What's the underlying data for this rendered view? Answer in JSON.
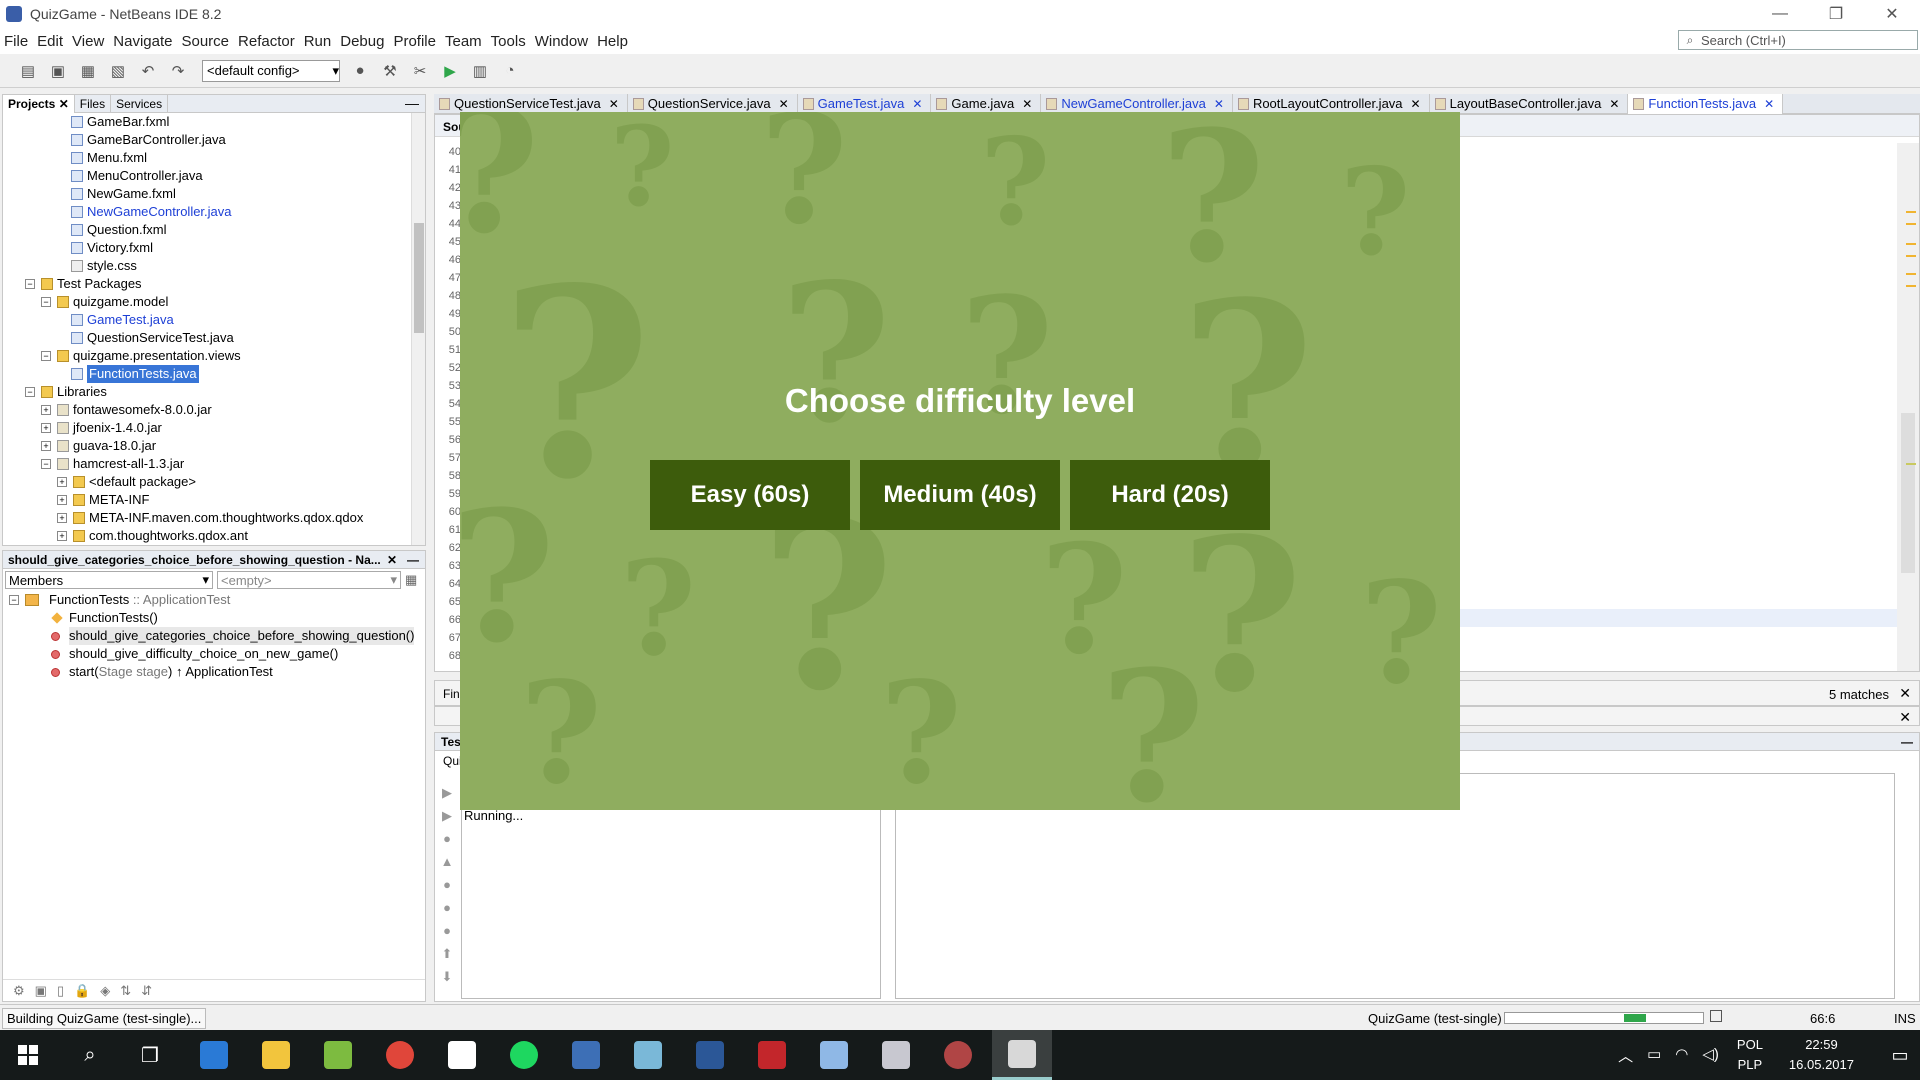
{
  "window": {
    "title": "QuizGame - NetBeans IDE 8.2",
    "controls": [
      "—",
      "❐",
      "✕"
    ]
  },
  "menu": [
    "File",
    "Edit",
    "View",
    "Navigate",
    "Source",
    "Refactor",
    "Run",
    "Debug",
    "Profile",
    "Team",
    "Tools",
    "Window",
    "Help"
  ],
  "search": {
    "placeholder": "Search (Ctrl+I)"
  },
  "toolbar": {
    "config": "<default config>"
  },
  "projects_panel": {
    "tabs": [
      "Projects",
      "Files",
      "Services"
    ],
    "tree": [
      {
        "label": "GameBar.fxml",
        "kind": "file",
        "level": 4
      },
      {
        "label": "GameBarController.java",
        "kind": "file",
        "level": 4
      },
      {
        "label": "Menu.fxml",
        "kind": "file",
        "level": 4
      },
      {
        "label": "MenuController.java",
        "kind": "file",
        "level": 4
      },
      {
        "label": "NewGame.fxml",
        "kind": "file",
        "level": 4
      },
      {
        "label": "NewGameController.java",
        "kind": "file",
        "level": 4,
        "style": "blue"
      },
      {
        "label": "Question.fxml",
        "kind": "file",
        "level": 4
      },
      {
        "label": "Victory.fxml",
        "kind": "file",
        "level": 4
      },
      {
        "label": "style.css",
        "kind": "css",
        "level": 4
      },
      {
        "label": "Test Packages",
        "kind": "folder",
        "level": 1,
        "expander": "−"
      },
      {
        "label": "quizgame.model",
        "kind": "folder",
        "level": 2,
        "expander": "−"
      },
      {
        "label": "GameTest.java",
        "kind": "file",
        "level": 4,
        "style": "blue"
      },
      {
        "label": "QuestionServiceTest.java",
        "kind": "file",
        "level": 4
      },
      {
        "label": "quizgame.presentation.views",
        "kind": "folder",
        "level": 2,
        "expander": "−"
      },
      {
        "label": "FunctionTests.java",
        "kind": "file",
        "level": 4,
        "style": "sel"
      },
      {
        "label": "Libraries",
        "kind": "folder",
        "level": 1,
        "expander": "−"
      },
      {
        "label": "fontawesomefx-8.0.0.jar",
        "kind": "jar",
        "level": 2,
        "expander": "+"
      },
      {
        "label": "jfoenix-1.4.0.jar",
        "kind": "jar",
        "level": 2,
        "expander": "+"
      },
      {
        "label": "guava-18.0.jar",
        "kind": "jar",
        "level": 2,
        "expander": "+"
      },
      {
        "label": "hamcrest-all-1.3.jar",
        "kind": "jar",
        "level": 2,
        "expander": "−"
      },
      {
        "label": "<default package>",
        "kind": "folder",
        "level": 3,
        "expander": "+"
      },
      {
        "label": "META-INF",
        "kind": "folder",
        "level": 3,
        "expander": "+"
      },
      {
        "label": "META-INF.maven.com.thoughtworks.qdox.qdox",
        "kind": "folder",
        "level": 3,
        "expander": "+"
      },
      {
        "label": "com.thoughtworks.qdox.ant",
        "kind": "folder",
        "level": 3,
        "expander": "+"
      }
    ]
  },
  "navigator": {
    "title": "should_give_categories_choice_before_showing_question - Na...",
    "filter": "Members",
    "filter2": "<empty>",
    "class_name": "FunctionTests",
    "class_super": " :: ApplicationTest",
    "members": [
      {
        "label": "FunctionTests()",
        "kind": "constructor"
      },
      {
        "label": "should_give_categories_choice_before_showing_question()",
        "kind": "method",
        "highlight": true
      },
      {
        "label": "should_give_difficulty_choice_on_new_game()",
        "kind": "method"
      },
      {
        "label": "start(",
        "grey": "Stage stage",
        "after": ") ↑ ApplicationTest",
        "kind": "method"
      }
    ]
  },
  "editor": {
    "tabs": [
      {
        "label": "QuestionServiceTest.java",
        "style": ""
      },
      {
        "label": "QuestionService.java",
        "style": ""
      },
      {
        "label": "GameTest.java",
        "style": "blue"
      },
      {
        "label": "Game.java",
        "style": ""
      },
      {
        "label": "NewGameController.java",
        "style": "blue"
      },
      {
        "label": "RootLayoutController.java",
        "style": ""
      },
      {
        "label": "LayoutBaseController.java",
        "style": ""
      },
      {
        "label": "FunctionTests.java",
        "style": "active"
      }
    ],
    "subtab": "Sou",
    "line_numbers": [
      "40",
      "41",
      "42",
      "43",
      "44",
      "45",
      "46",
      "47",
      "48",
      "49",
      "50",
      "51",
      "52",
      "53",
      "54",
      "55",
      "56",
      "57",
      "58",
      "59",
      "60",
      "61",
      "62",
      "63",
      "64",
      "65",
      "66",
      "67",
      "68"
    ]
  },
  "find_bar": {
    "label": "Fin",
    "matches": "5 matches"
  },
  "test_results": {
    "title": "Tes",
    "sub": "Qui",
    "status": "Running..."
  },
  "statusbar": {
    "left": "Building QuizGame (test-single)...",
    "task": "QuizGame (test-single)",
    "progress": 0.38,
    "position": "66:6",
    "mode": "INS"
  },
  "game": {
    "title": "Choose difficulty level",
    "buttons": [
      "Easy (60s)",
      "Medium (40s)",
      "Hard (20s)"
    ]
  },
  "taskbar": {
    "language": "POL",
    "language2": "PLP",
    "time": "22:59",
    "date": "16.05.2017",
    "colors": {
      "edge": "#2a7ad6",
      "explorer": "#f2c53d",
      "android": "#7dbb40",
      "chrome": "#e0463a",
      "store": "#ffffff",
      "spotify": "#1ed760",
      "virtualbox": "#3d6fb6",
      "notes": "#7ab8d8",
      "word": "#2b5797",
      "acrobat": "#c3262b",
      "cube": "#8fb8e6",
      "mail": "#c8c8d0",
      "avatar": "#b04545",
      "java": "#d8d8d8"
    }
  }
}
